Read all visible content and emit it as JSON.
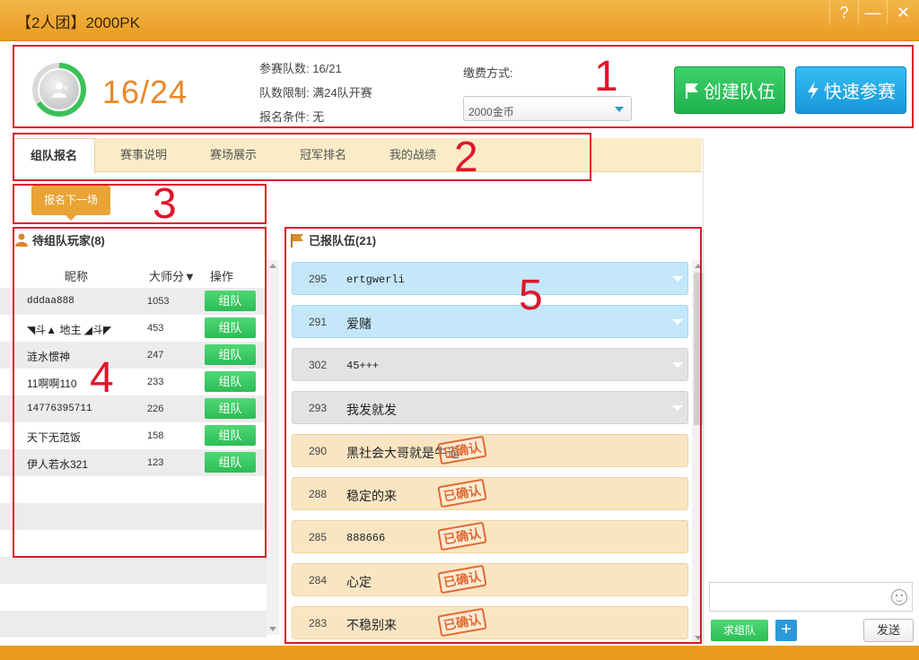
{
  "window": {
    "title": "【2人团】2000PK",
    "help": "?",
    "minimize": "—",
    "close": "✕"
  },
  "header": {
    "count": "16/24",
    "teams_joined": "参赛队数: 16/21",
    "team_limit": "队数限制: 满24队开赛",
    "condition": "报名条件: 无",
    "pay_label": "缴费方式:",
    "pay_value": "2000金币",
    "create_label": "创建队伍",
    "quick_label": "快速参赛"
  },
  "tabs": [
    "组队报名",
    "赛事说明",
    "赛场展示",
    "冠军排名",
    "我的战绩"
  ],
  "next_match": "报名下一场",
  "waiting": {
    "title": "待组队玩家(8)",
    "col_nick": "昵称",
    "col_score": "大师分▼",
    "col_op": "操作",
    "team_btn": "组队",
    "players": [
      {
        "nick": "dddaa888",
        "score": "1053"
      },
      {
        "nick": "◥斗▲ 地主 ◢斗◤",
        "score": "453"
      },
      {
        "nick": "涟水惯神",
        "score": "247"
      },
      {
        "nick": "11啊啊110",
        "score": "233"
      },
      {
        "nick": "14776395711",
        "score": "226"
      },
      {
        "nick": "天下无范饭",
        "score": "158"
      },
      {
        "nick": "伊人若水321",
        "score": "123"
      }
    ]
  },
  "registered": {
    "title": "已报队伍(21)",
    "stamp": "已确认",
    "teams": [
      {
        "id": "295",
        "name": "ertgwerli",
        "style": "blue"
      },
      {
        "id": "291",
        "name": "爱赌",
        "style": "blue"
      },
      {
        "id": "302",
        "name": "45+++",
        "style": "gray"
      },
      {
        "id": "293",
        "name": "我发就发",
        "style": "gray"
      },
      {
        "id": "290",
        "name": "黑社会大哥就是牛逼",
        "style": "tan"
      },
      {
        "id": "288",
        "name": "稳定的来",
        "style": "tan"
      },
      {
        "id": "285",
        "name": "888666",
        "style": "tan"
      },
      {
        "id": "284",
        "name": "心定",
        "style": "tan"
      },
      {
        "id": "283",
        "name": "不稳别来",
        "style": "tan"
      }
    ]
  },
  "chat": {
    "ask_btn": "求组队",
    "plus_btn": "+",
    "send_btn": "发送"
  },
  "annotations": [
    "1",
    "2",
    "3",
    "4",
    "5"
  ],
  "colors": {
    "accent": "#e99b20",
    "green": "#2cbd55",
    "blue": "#1897d9",
    "annotation": "#e0162b"
  }
}
